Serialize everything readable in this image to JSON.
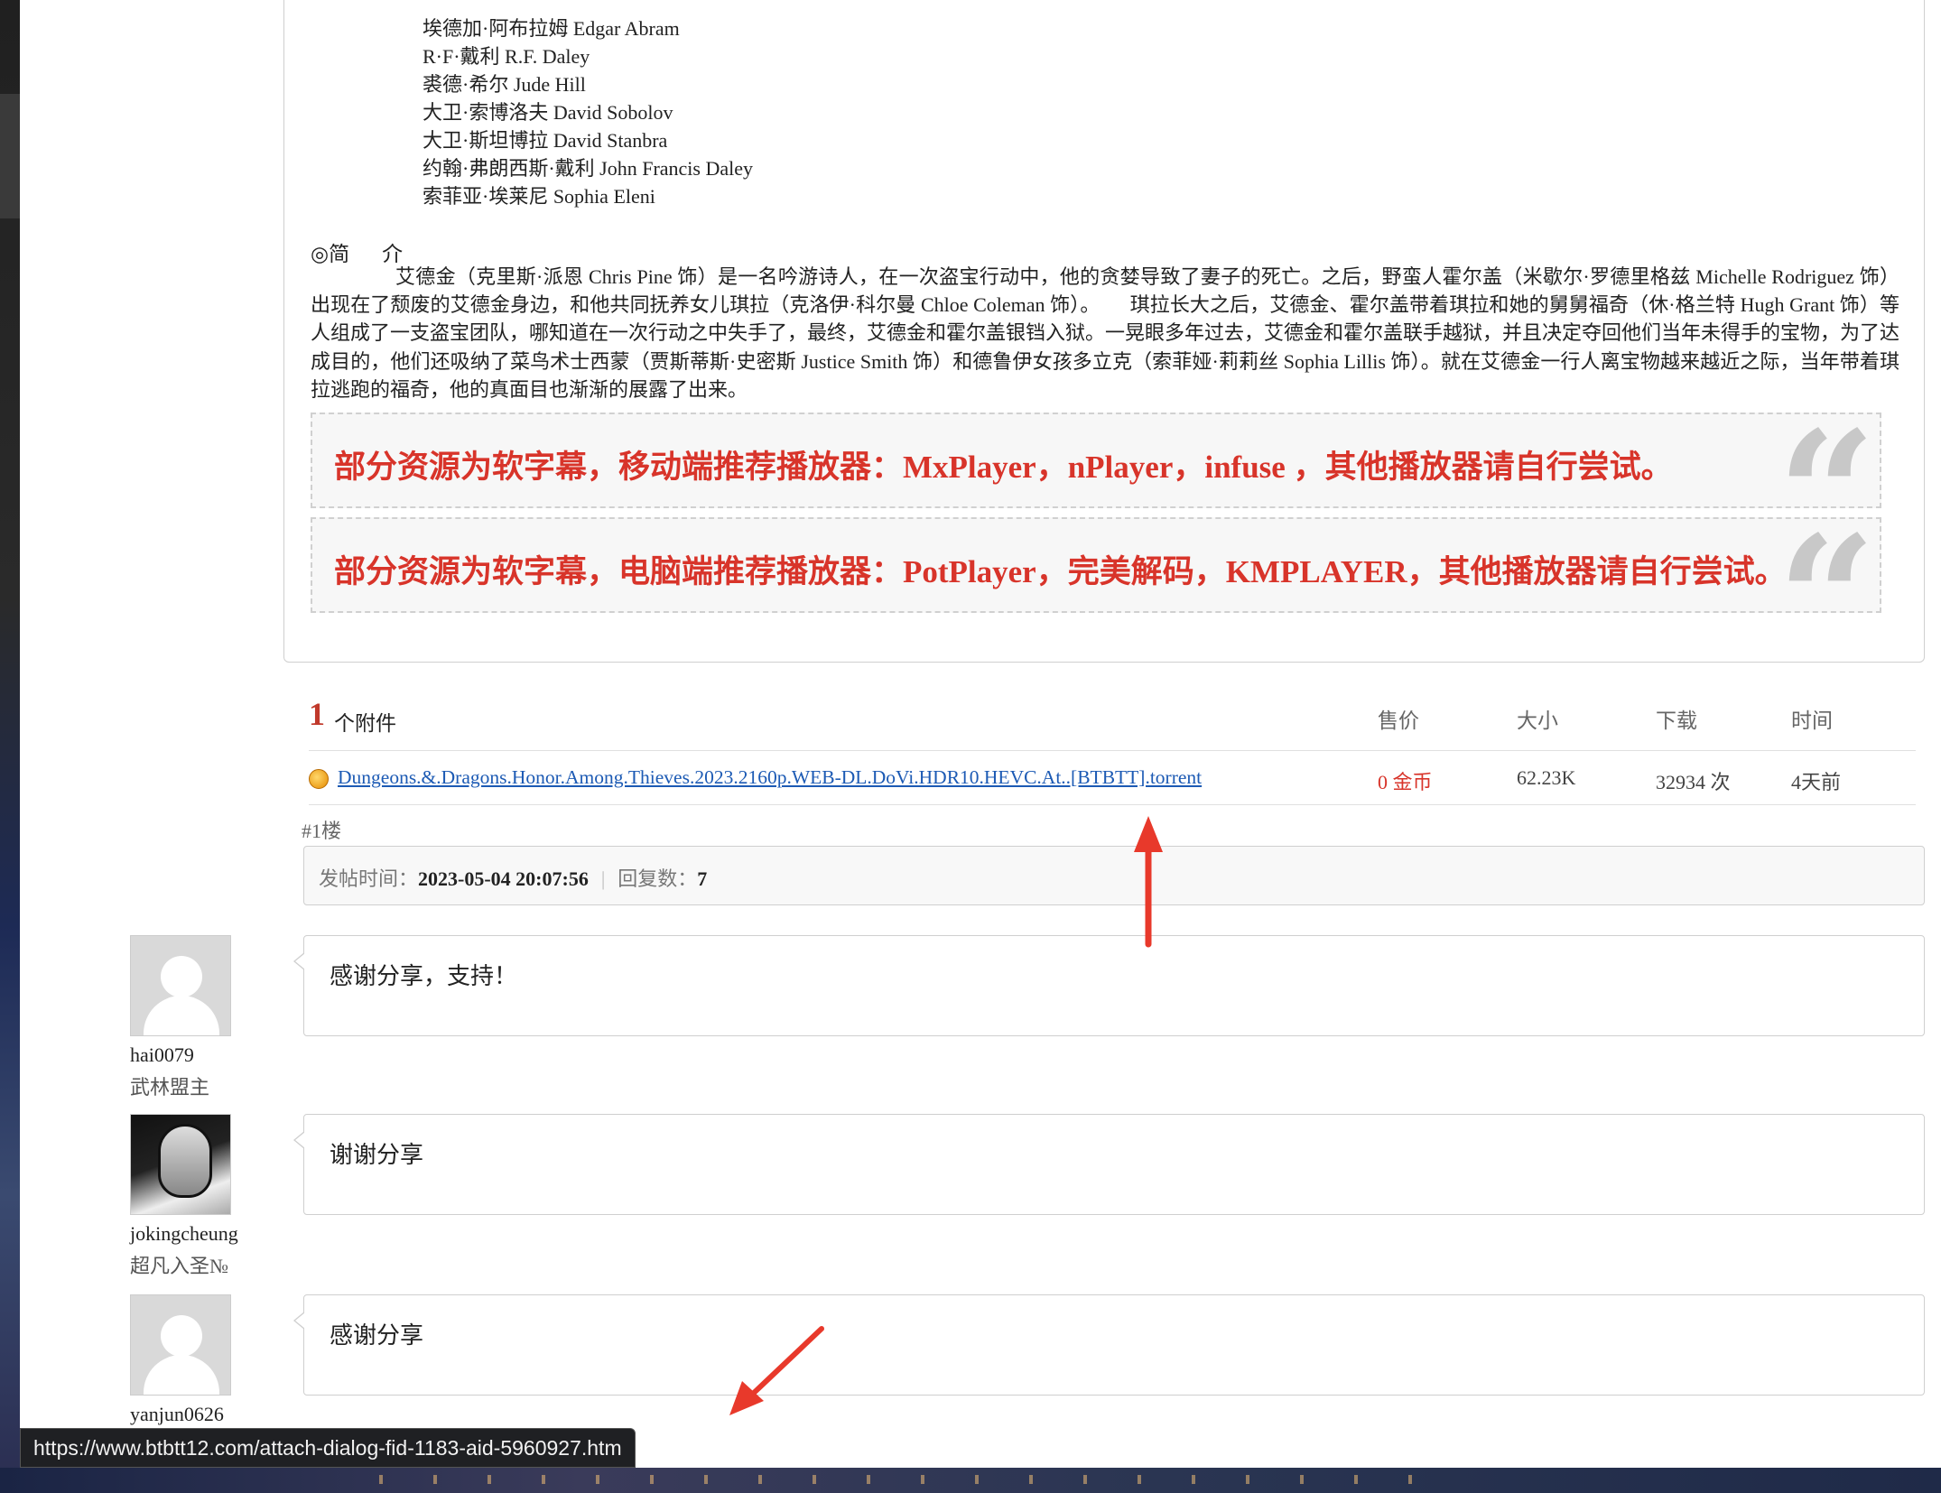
{
  "cast": [
    "埃德加·阿布拉姆 Edgar Abram",
    "R·F·戴利 R.F. Daley",
    "裘德·希尔 Jude Hill",
    "大卫·索博洛夫 David Sobolov",
    "大卫·斯坦博拉 David Stanbra",
    "约翰·弗朗西斯·戴利 John Francis Daley",
    "索菲亚·埃莱尼 Sophia Eleni"
  ],
  "intro": {
    "symbol": "◎简",
    "symbol2": "介",
    "body": "艾德金（克里斯·派恩 Chris Pine 饰）是一名吟游诗人，在一次盗宝行动中，他的贪婪导致了妻子的死亡。之后，野蛮人霍尔盖（米歇尔·罗德里格兹 Michelle Rodriguez 饰）出现在了颓废的艾德金身边，和他共同抚养女儿琪拉（克洛伊·科尔曼 Chloe Coleman 饰）。　　琪拉长大之后，艾德金、霍尔盖带着琪拉和她的舅舅福奇（休·格兰特 Hugh Grant 饰）等人组成了一支盗宝团队，哪知道在一次行动之中失手了，最终，艾德金和霍尔盖银铛入狱。一晃眼多年过去，艾德金和霍尔盖联手越狱，并且决定夺回他们当年未得手的宝物，为了达成目的，他们还吸纳了菜鸟术士西蒙（贾斯蒂斯·史密斯 Justice Smith 饰）和德鲁伊女孩多立克（索菲娅·莉莉丝 Sophia Lillis 饰）。就在艾德金一行人离宝物越来越近之际，当年带着琪拉逃跑的福奇，他的真面目也渐渐的展露了出来。"
  },
  "notices": [
    "部分资源为软字幕，移动端推荐播放器：MxPlayer，nPlayer，infuse ，其他播放器请自行尝试。",
    "部分资源为软字幕，电脑端推荐播放器：PotPlayer，完美解码，KMPLAYER，其他播放器请自行尝试。"
  ],
  "attachments": {
    "count": "1",
    "count_label": "个附件",
    "headers": {
      "price": "售价",
      "size": "大小",
      "downloads": "下载",
      "time": "时间"
    },
    "rows": [
      {
        "icon": "torrent-file-icon",
        "filename": "Dungeons.&.Dragons.Honor.Among.Thieves.2023.2160p.WEB-DL.DoVi.HDR10.HEVC.At..[BTBTT].torrent",
        "price": "0 金币",
        "size": "62.23K",
        "downloads": "32934 次",
        "time": "4天前"
      }
    ]
  },
  "post_meta": {
    "floor": "#1楼",
    "posted_label": "发帖时间：",
    "posted_time": "2023-05-04 20:07:56",
    "separator": "|",
    "replies_label": "回复数：",
    "replies_count": "7"
  },
  "replies": [
    {
      "username": "hai0079",
      "rank": "武林盟主",
      "text": "感谢分享，支持！",
      "avatar": "default-avatar"
    },
    {
      "username": "jokingcheung",
      "rank": "超凡入圣№",
      "text": "谢谢分享",
      "avatar": "photo-avatar"
    },
    {
      "username": "yanjun0626",
      "rank": "",
      "text": "感谢分享",
      "avatar": "default-avatar"
    }
  ],
  "status_bar": {
    "url": "https://www.btbtt12.com/attach-dialog-fid-1183-aid-5960927.htm"
  },
  "colors": {
    "notice_text": "#d8342a",
    "link": "#1c5ab4",
    "annotation_arrow": "#e8392b"
  }
}
